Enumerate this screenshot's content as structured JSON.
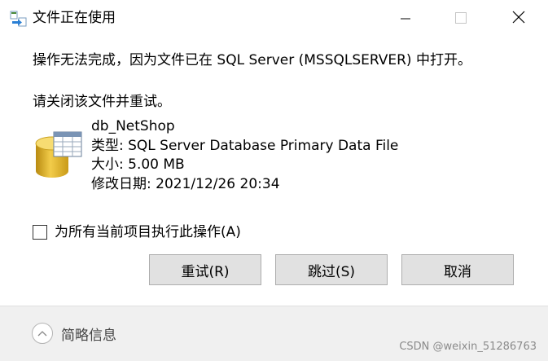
{
  "window": {
    "title": "文件正在使用",
    "min_icon": "minimize-icon",
    "max_icon": "maximize-icon",
    "close_icon": "close-icon"
  },
  "message": {
    "line1": "操作无法完成，因为文件已在 SQL Server (MSSQLSERVER) 中打开。",
    "line2": "请关闭该文件并重试。"
  },
  "file": {
    "icon": "database-file-icon",
    "name": "db_NetShop",
    "type": "类型: SQL Server Database Primary Data File",
    "size": "大小: 5.00 MB",
    "modified": "修改日期: 2021/12/26 20:34"
  },
  "apply_all": {
    "label": "为所有当前项目执行此操作(A)",
    "checked": false
  },
  "buttons": {
    "retry": "重试(R)",
    "skip": "跳过(S)",
    "cancel": "取消"
  },
  "footer": {
    "details_label": "简略信息",
    "details_icon": "chevron-up-icon",
    "watermark": "CSDN @weixin_51286763"
  }
}
